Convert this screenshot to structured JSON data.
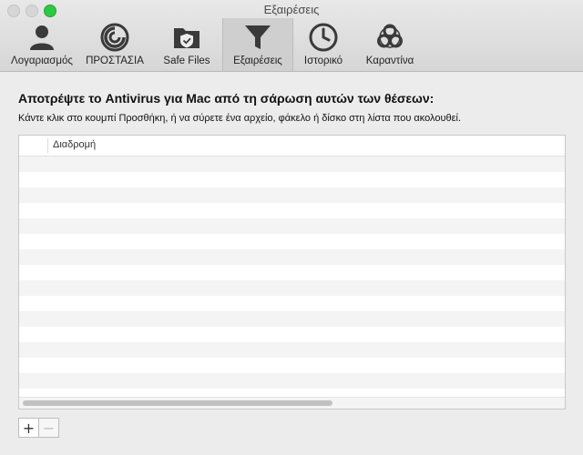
{
  "window": {
    "title": "Εξαιρέσεις"
  },
  "toolbar": {
    "tabs": [
      {
        "label": "Λογαριασμός",
        "icon": "user-icon"
      },
      {
        "label": "ΠΡΟΣΤΑΣΙΑ",
        "icon": "protection-icon"
      },
      {
        "label": "Safe Files",
        "icon": "shield-folder-icon"
      },
      {
        "label": "Εξαιρέσεις",
        "icon": "funnel-icon",
        "active": true
      },
      {
        "label": "Ιστορικό",
        "icon": "clock-icon"
      },
      {
        "label": "Καραντίνα",
        "icon": "biohazard-icon"
      }
    ]
  },
  "content": {
    "heading": "Αποτρέψτε το Antivirus για Mac από τη σάρωση αυτών των θέσεων:",
    "instructions": "Κάντε κλικ στο κουμπί Προσθήκη, ή να σύρετε ένα αρχείο, φάκελο ή δίσκο στη λίστα που ακολουθεί.",
    "table": {
      "column_path": "Διαδρομή",
      "rows": []
    }
  },
  "buttons": {
    "add": "+",
    "remove": "−"
  },
  "colors": {
    "active_tab_bg": "#cfcfcf",
    "maximize_green": "#2fc845"
  }
}
